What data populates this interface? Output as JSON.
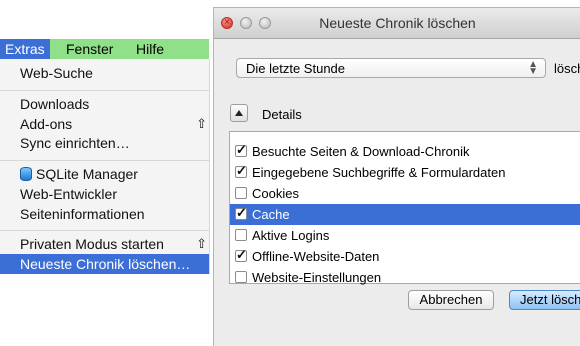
{
  "menubar": {
    "items": [
      "Extras",
      "Fenster",
      "Hilfe"
    ],
    "active": "Extras"
  },
  "menu": {
    "items": [
      {
        "label": "Web-Suche"
      },
      {
        "label": "Downloads"
      },
      {
        "label": "Add-ons",
        "shortcut": "⇧"
      },
      {
        "label": "Sync einrichten…"
      },
      {
        "label": "SQLite Manager",
        "icon": "database-icon"
      },
      {
        "label": "Web-Entwickler"
      },
      {
        "label": "Seiteninformationen"
      },
      {
        "label": "Privaten Modus starten",
        "shortcut": "⇧"
      },
      {
        "label": "Neueste Chronik löschen…",
        "highlighted": true
      }
    ]
  },
  "dialog": {
    "title": "Neueste Chronik löschen",
    "range_select": {
      "value": "Die letzte Stunde"
    },
    "range_label": "lösch",
    "details_label": "Details",
    "checkboxes": [
      {
        "label": "Besuchte Seiten & Download-Chronik",
        "checked": true
      },
      {
        "label": "Eingegebene Suchbegriffe & Formulardaten",
        "checked": true
      },
      {
        "label": "Cookies",
        "checked": false
      },
      {
        "label": "Cache",
        "checked": true,
        "selected": true
      },
      {
        "label": "Aktive Logins",
        "checked": false
      },
      {
        "label": "Offline-Website-Daten",
        "checked": true
      },
      {
        "label": "Website-Einstellungen",
        "checked": false
      }
    ],
    "cancel_label": "Abbrechen",
    "clear_label": "Jetzt lösch"
  },
  "colors": {
    "menubar_bg": "#8fe089",
    "highlight": "#3b6fd6"
  }
}
